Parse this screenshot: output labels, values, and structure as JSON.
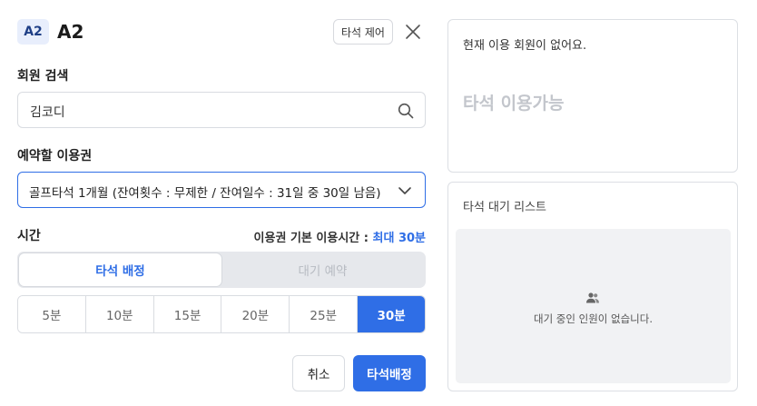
{
  "header": {
    "badge": "A2",
    "title": "A2",
    "control_label": "타석 제어"
  },
  "member_search": {
    "label": "회원 검색",
    "value": "김코디"
  },
  "pass": {
    "label": "예약할 이용권",
    "selected": "골프타석 1개월 (잔여횟수 : 무제한 / 잔여일수 : 31일 중 30일 남음)"
  },
  "time": {
    "label": "시간",
    "info_prefix": "이용권 기본 이용시간 : ",
    "info_value": "최대 30분",
    "tabs": [
      "타석 배정",
      "대기 예약"
    ],
    "active_tab": "타석 배정",
    "durations": [
      "5분",
      "10분",
      "15분",
      "20분",
      "25분",
      "30분"
    ],
    "selected_duration": "30분"
  },
  "footer": {
    "cancel_label": "취소",
    "assign_label": "타석배정"
  },
  "status_panel": {
    "message": "현재 이용 회원이 없어요.",
    "availability": "타석 이용가능"
  },
  "wait_panel": {
    "title": "타석 대기 리스트",
    "empty_message": "대기 중인 인원이 없습니다."
  },
  "colors": {
    "accent": "#2f6ee6",
    "badge_bg": "#e8eefc",
    "muted": "#c3c6cc"
  },
  "icons": [
    "search-icon",
    "chevron-down-icon",
    "close-icon",
    "people-icon"
  ]
}
